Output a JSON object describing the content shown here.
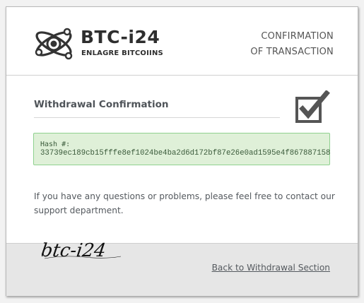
{
  "header": {
    "brand_name": "BTC-i24",
    "brand_tagline": "ENLAGRE BITCOIINS",
    "title_line1": "CONFIRMATION",
    "title_line2": "OF TRANSACTION"
  },
  "main": {
    "section_title": "Withdrawal Confirmation",
    "hash_label": "Hash #:",
    "hash_value": "33739ec189cb15fffe8ef1024be4ba2d6d172bf87e26e0ad1595e4f867887158",
    "message": "If you have any questions or problems, please feel free to contact our support department."
  },
  "footer": {
    "signature_text": "btc-i24",
    "back_link_label": "Back to Withdrawal Section"
  },
  "icons": {
    "logo": "atom-logo-icon",
    "status": "checkbox-checked-icon"
  },
  "colors": {
    "hash_background": "#dff0d8",
    "hash_border": "#8fd18f",
    "footer_background": "#e6e6e6"
  }
}
